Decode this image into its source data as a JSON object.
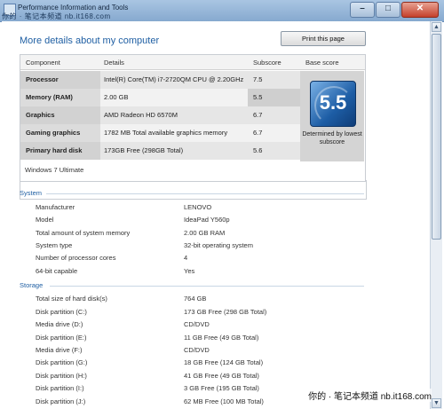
{
  "window": {
    "title": "Performance Information and Tools",
    "watermark_top": "你的 · 笔记本频道  nb.it168.com"
  },
  "header": {
    "heading": "More details about my computer",
    "print_button": "Print this page"
  },
  "score_table": {
    "headers": {
      "component": "Component",
      "details": "Details",
      "subscore": "Subscore",
      "base": "Base score"
    },
    "rows": [
      {
        "component": "Processor",
        "details": "Intel(R) Core(TM) i7-2720QM CPU @ 2.20GHz",
        "subscore": "7.5"
      },
      {
        "component": "Memory (RAM)",
        "details": "2.00 GB",
        "subscore": "5.5"
      },
      {
        "component": "Graphics",
        "details": "AMD Radeon HD 6570M",
        "subscore": "6.7"
      },
      {
        "component": "Gaming graphics",
        "details": "1782 MB Total available graphics memory",
        "subscore": "6.7"
      },
      {
        "component": "Primary hard disk",
        "details": "173GB Free (298GB Total)",
        "subscore": "5.6"
      }
    ],
    "base_score": "5.5",
    "base_caption": "Determined by lowest subscore",
    "os": "Windows 7 Ultimate"
  },
  "system": {
    "title": "System",
    "items": [
      {
        "label": "Manufacturer",
        "value": "LENOVO"
      },
      {
        "label": "Model",
        "value": "IdeaPad Y560p"
      },
      {
        "label": "Total amount of system memory",
        "value": "2.00 GB RAM"
      },
      {
        "label": "System type",
        "value": "32-bit operating system"
      },
      {
        "label": "Number of processor cores",
        "value": "4"
      },
      {
        "label": "64-bit capable",
        "value": "Yes"
      }
    ]
  },
  "storage": {
    "title": "Storage",
    "items": [
      {
        "label": "Total size of hard disk(s)",
        "value": "764 GB"
      },
      {
        "label": "Disk partition (C:)",
        "value": "173 GB Free (298 GB Total)"
      },
      {
        "label": "Media drive (D:)",
        "value": "CD/DVD"
      },
      {
        "label": "Disk partition (E:)",
        "value": "11 GB Free (49 GB Total)"
      },
      {
        "label": "Media drive (F:)",
        "value": "CD/DVD"
      },
      {
        "label": "Disk partition (G:)",
        "value": "18 GB Free (124 GB Total)"
      },
      {
        "label": "Disk partition (H:)",
        "value": "41 GB Free (49 GB Total)"
      },
      {
        "label": "Disk partition (I:)",
        "value": "3 GB Free (195 GB Total)"
      },
      {
        "label": "Disk partition (J:)",
        "value": "62 MB Free (100 MB Total)"
      }
    ]
  },
  "watermark_bottom": "你的 · 笔记本频道  nb.it168.com",
  "icons": {
    "window": "window-icon",
    "minimize": "minimize-icon",
    "maximize": "maximize-icon",
    "close": "close-icon",
    "scroll_up": "scroll-up-icon",
    "scroll_down": "scroll-down-icon",
    "badge": "wei-score-badge-icon"
  },
  "colors": {
    "accent": "#1f5fa3",
    "badge": "#1d5da5",
    "close": "#c5402b"
  }
}
